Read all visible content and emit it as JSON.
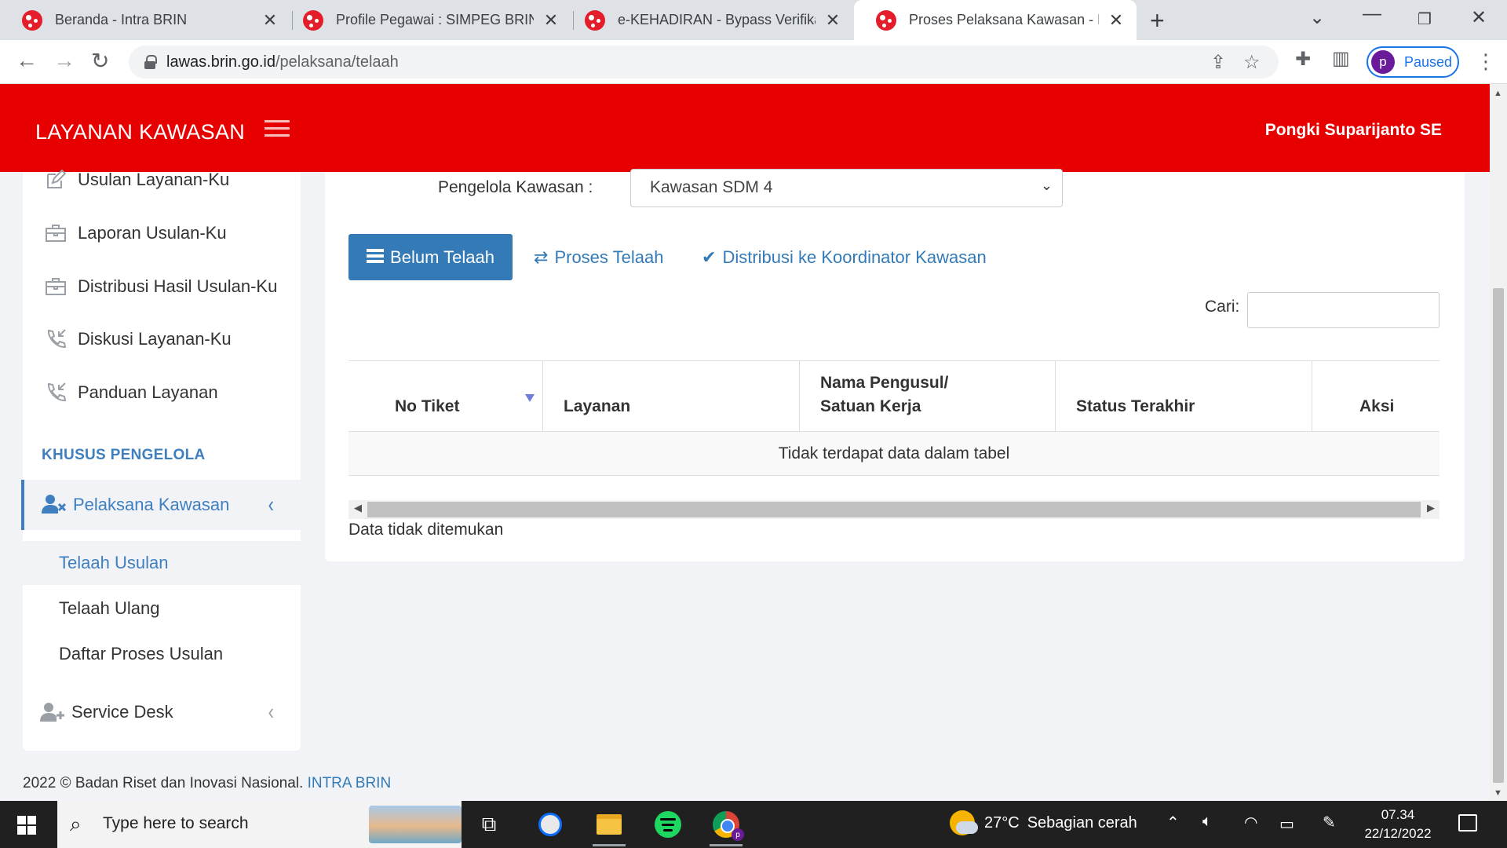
{
  "browser": {
    "tabs": [
      {
        "title": "Beranda - Intra BRIN",
        "close": "✕",
        "active": false
      },
      {
        "title": "Profile Pegawai : SIMPEG BRIN",
        "close": "✕",
        "active": false
      },
      {
        "title": "e-KEHADIRAN - Bypass Verifikasi",
        "close": "✕",
        "active": false
      },
      {
        "title": "Proses Pelaksana Kawasan - Laya",
        "close": "✕",
        "active": true
      }
    ],
    "new_tab": "+",
    "url_host": "lawas.brin.go.id",
    "url_path": "/pelaksana/telaah",
    "profile_initial": "p",
    "profile_status": "Paused"
  },
  "header": {
    "brand": "LAYANAN KAWASAN",
    "user": "Pongki Suparijanto SE",
    "accent": "#e60000"
  },
  "sidebar": {
    "items": [
      {
        "label": "Usulan Layanan-Ku",
        "icon": "edit-icon"
      },
      {
        "label": "Laporan Usulan-Ku",
        "icon": "briefcase-icon"
      },
      {
        "label": "Distribusi Hasil Usulan-Ku",
        "icon": "briefcase-icon"
      },
      {
        "label": "Diskusi Layanan-Ku",
        "icon": "phone-incoming-icon"
      },
      {
        "label": "Panduan Layanan",
        "icon": "phone-incoming-icon"
      }
    ],
    "section_label": "KHUSUS PENGELOLA",
    "active_menu": {
      "label": "Pelaksana Kawasan",
      "icon": "user-times-icon",
      "chevron": "‹"
    },
    "submenu": [
      {
        "label": "Telaah Usulan",
        "current": true
      },
      {
        "label": "Telaah Ulang",
        "current": false
      },
      {
        "label": "Daftar Proses Usulan",
        "current": false
      }
    ],
    "service_desk": {
      "label": "Service Desk",
      "icon": "user-plus-icon",
      "chevron": "‹"
    }
  },
  "main": {
    "pengelola_label": "Pengelola Kawasan :",
    "pengelola_value": "Kawasan SDM 4",
    "tabs": [
      {
        "label": "Belum Telaah",
        "icon": "list-icon",
        "active": true
      },
      {
        "label": "Proses Telaah",
        "icon": "exchange-icon",
        "active": false
      },
      {
        "label": "Distribusi ke Koordinator Kawasan",
        "icon": "check-icon",
        "active": false
      }
    ],
    "search_label": "Cari:",
    "search_value": "",
    "table": {
      "columns": [
        "No Tiket",
        "Layanan",
        "Nama Pengusul/ Satuan Kerja",
        "Status Terakhir",
        "Aksi"
      ],
      "empty_message": "Tidak terdapat data dalam tabel"
    },
    "info": "Data tidak ditemukan"
  },
  "footer": {
    "text": "2022 © Badan Riset dan Inovasi Nasional.",
    "link": "INTRA BRIN"
  },
  "taskbar": {
    "search_placeholder": "Type here to search",
    "weather_temp": "27°C",
    "weather_desc": "Sebagian cerah",
    "time": "07.34",
    "date": "22/12/2022"
  }
}
